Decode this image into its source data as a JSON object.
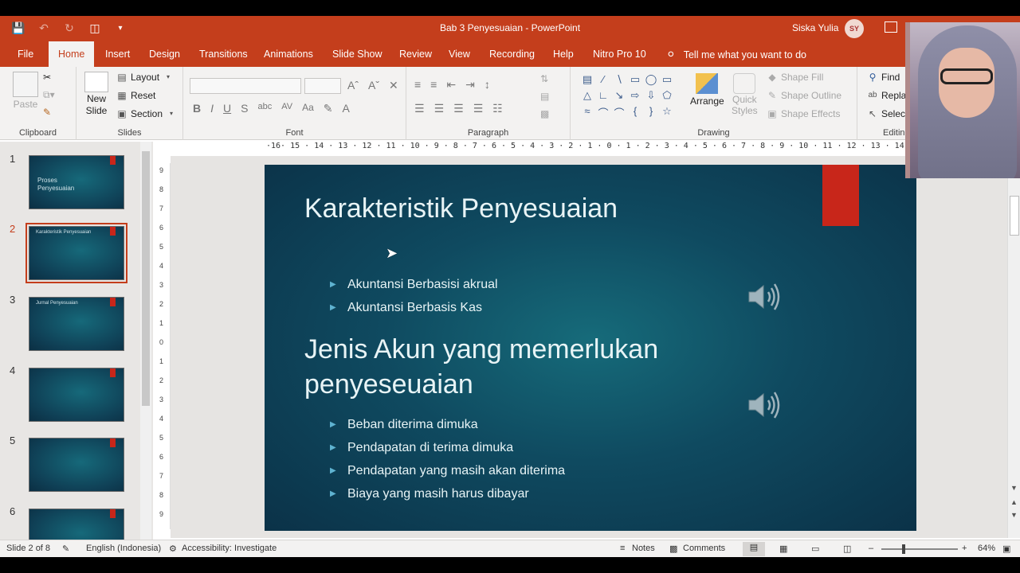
{
  "window": {
    "title": "Bab 3 Penyesuaian  -  PowerPoint",
    "user_name": "Siska Yulia",
    "user_initials": "SY"
  },
  "tabs": [
    {
      "label": "File"
    },
    {
      "label": "Home"
    },
    {
      "label": "Insert"
    },
    {
      "label": "Design"
    },
    {
      "label": "Transitions"
    },
    {
      "label": "Animations"
    },
    {
      "label": "Slide Show"
    },
    {
      "label": "Review"
    },
    {
      "label": "View"
    },
    {
      "label": "Recording"
    },
    {
      "label": "Help"
    },
    {
      "label": "Nitro Pro 10"
    }
  ],
  "tell_me": "Tell me what you want to do",
  "ribbon": {
    "clipboard": {
      "label": "Clipboard",
      "paste": "Paste"
    },
    "slides": {
      "label": "Slides",
      "new_slide_1": "New",
      "new_slide_2": "Slide",
      "layout": "Layout",
      "reset": "Reset",
      "section": "Section"
    },
    "font": {
      "label": "Font"
    },
    "paragraph": {
      "label": "Paragraph"
    },
    "drawing": {
      "label": "Drawing",
      "arrange": "Arrange",
      "quick_styles_1": "Quick",
      "quick_styles_2": "Styles",
      "shape_fill": "Shape Fill",
      "shape_outline": "Shape Outline",
      "shape_effects": "Shape Effects"
    },
    "editing": {
      "label": "Editin",
      "find": "Find",
      "replace": "Replac",
      "select": "Select"
    }
  },
  "ruler_text": "·16· 15 · 14 · 13 · 12 · 11 · 10 · 9 · 8 · 7 · 6 · 5 · 4 · 3 · 2 · 1 · 0 · 1 · 2 · 3 · 4 · 5 · 6 · 7 · 8 · 9 · 10 · 11 · 12 · 13 · 14 · 15 · 16",
  "vruler": [
    "9",
    "8",
    "7",
    "6",
    "5",
    "4",
    "3",
    "2",
    "1",
    "0",
    "1",
    "2",
    "3",
    "4",
    "5",
    "6",
    "7",
    "8",
    "9"
  ],
  "thumbnails": [
    {
      "num": "1",
      "title": "Proses\nPenyesuaian"
    },
    {
      "num": "2",
      "title": "Karakteristik Penyesuaian"
    },
    {
      "num": "3",
      "title": "Jurnal Penyesuaian"
    },
    {
      "num": "4",
      "title": ""
    },
    {
      "num": "5",
      "title": ""
    },
    {
      "num": "6",
      "title": ""
    }
  ],
  "slide": {
    "title1": "Karakteristik Penyesuaian",
    "bullets1": [
      "Akuntansi Berbasisi akrual",
      "Akuntansi Berbasis Kas"
    ],
    "title2": "Jenis Akun yang memerlukan penyeseuaian",
    "bullets2": [
      "Beban diterima dimuka",
      "Pendapatan di terima dimuka",
      "Pendapatan yang masih akan diterima",
      "Biaya yang masih harus dibayar"
    ]
  },
  "status": {
    "slide_of": "Slide 2 of 8",
    "language": "English (Indonesia)",
    "accessibility": "Accessibility: Investigate",
    "notes": "Notes",
    "comments": "Comments",
    "zoom": "64%"
  },
  "colors": {
    "accent": "#c43e1c",
    "slide_bg": "#0f4a60",
    "slide_tag": "#c8261a",
    "bullet": "#5fb3d1"
  }
}
